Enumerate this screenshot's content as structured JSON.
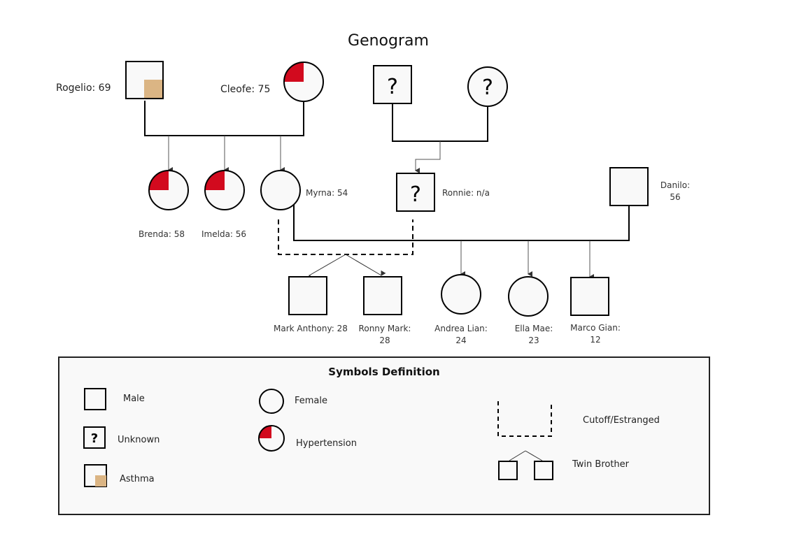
{
  "title": "Genogram",
  "colors": {
    "hypertension": "#d20a1e",
    "asthma": "#dbb584",
    "symbol_fill": "#f9f9f9",
    "line": "#000000",
    "child_line": "#555555"
  },
  "people": {
    "rogelio": {
      "label": "Rogelio: 69",
      "sex": "male",
      "conditions": [
        "asthma"
      ]
    },
    "cleofe": {
      "label": "Cleofe: 75",
      "sex": "female",
      "conditions": [
        "hypertension"
      ]
    },
    "unknown_father": {
      "label": "?",
      "sex": "male",
      "conditions": [
        "unknown"
      ]
    },
    "unknown_mother": {
      "label": "?",
      "sex": "female",
      "conditions": [
        "unknown"
      ]
    },
    "brenda": {
      "label": "Brenda: 58",
      "sex": "female",
      "conditions": [
        "hypertension"
      ]
    },
    "imelda": {
      "label": "Imelda: 56",
      "sex": "female",
      "conditions": [
        "hypertension"
      ]
    },
    "myrna": {
      "label": "Myrna: 54",
      "sex": "female",
      "conditions": []
    },
    "ronnie": {
      "label": "Ronnie: n/a",
      "sex": "male",
      "conditions": [
        "unknown"
      ],
      "symbol_text": "?"
    },
    "danilo": {
      "label_line1": "Danilo:",
      "label_line2": "56",
      "sex": "male",
      "conditions": []
    },
    "mark_anthony": {
      "label": "Mark Anthony: 28",
      "sex": "male",
      "conditions": [],
      "twin": true
    },
    "ronny_mark": {
      "label_line1": "Ronny Mark:",
      "label_line2": "28",
      "sex": "male",
      "conditions": [],
      "twin": true
    },
    "andrea_lian": {
      "label_line1": "Andrea Lian:",
      "label_line2": "24",
      "sex": "female",
      "conditions": []
    },
    "ella_mae": {
      "label_line1": "Ella Mae:",
      "label_line2": "23",
      "sex": "female",
      "conditions": []
    },
    "marco_gian": {
      "label_line1": "Marco Gian:",
      "label_line2": "12",
      "sex": "male",
      "conditions": []
    }
  },
  "relationships": [
    {
      "type": "marriage",
      "partners": [
        "rogelio",
        "cleofe"
      ],
      "children": [
        "brenda",
        "imelda",
        "myrna"
      ]
    },
    {
      "type": "marriage",
      "partners": [
        "unknown_father",
        "unknown_mother"
      ],
      "children": [
        "ronnie"
      ]
    },
    {
      "type": "cutoff",
      "partners": [
        "myrna",
        "ronnie"
      ],
      "children": [
        "mark_anthony",
        "ronny_mark"
      ],
      "twins": true
    },
    {
      "type": "marriage",
      "partners": [
        "myrna",
        "danilo"
      ],
      "children": [
        "andrea_lian",
        "ella_mae",
        "marco_gian"
      ]
    }
  ],
  "legend": {
    "title": "Symbols Definition",
    "items": [
      {
        "key": "male",
        "label": "Male"
      },
      {
        "key": "unknown",
        "label": "Unknown",
        "symbol_text": "?"
      },
      {
        "key": "asthma",
        "label": "Asthma"
      },
      {
        "key": "female",
        "label": "Female"
      },
      {
        "key": "hypertension",
        "label": "Hypertension"
      },
      {
        "key": "cutoff",
        "label": "Cutoff/Estranged"
      },
      {
        "key": "twins",
        "label": "Twin Brother"
      }
    ]
  }
}
